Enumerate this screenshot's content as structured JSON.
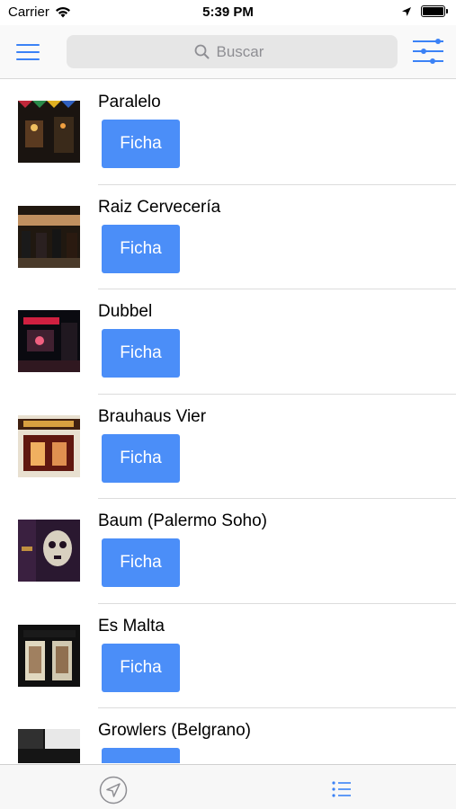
{
  "status_bar": {
    "carrier": "Carrier",
    "time": "5:39 PM"
  },
  "nav": {
    "search_placeholder": "Buscar",
    "accent_color": "#3b82f6"
  },
  "list": {
    "button_label": "Ficha",
    "button_color": "#4b8ef8",
    "items": [
      {
        "name": "Paralelo",
        "thumb": "bar-night-flags"
      },
      {
        "name": "Raiz Cervecería",
        "thumb": "bar-interior-crowd"
      },
      {
        "name": "Dubbel",
        "thumb": "bar-red-neon"
      },
      {
        "name": "Brauhaus Vier",
        "thumb": "bar-storefront-sign"
      },
      {
        "name": "Baum (Palermo Soho)",
        "thumb": "bar-skull-mural"
      },
      {
        "name": "Es Malta",
        "thumb": "bar-glass-front"
      },
      {
        "name": "Growlers (Belgrano)",
        "thumb": "bar-dark-sign"
      }
    ]
  },
  "tab_bar": {
    "icons": [
      "location-arrow-icon",
      "list-icon"
    ]
  }
}
